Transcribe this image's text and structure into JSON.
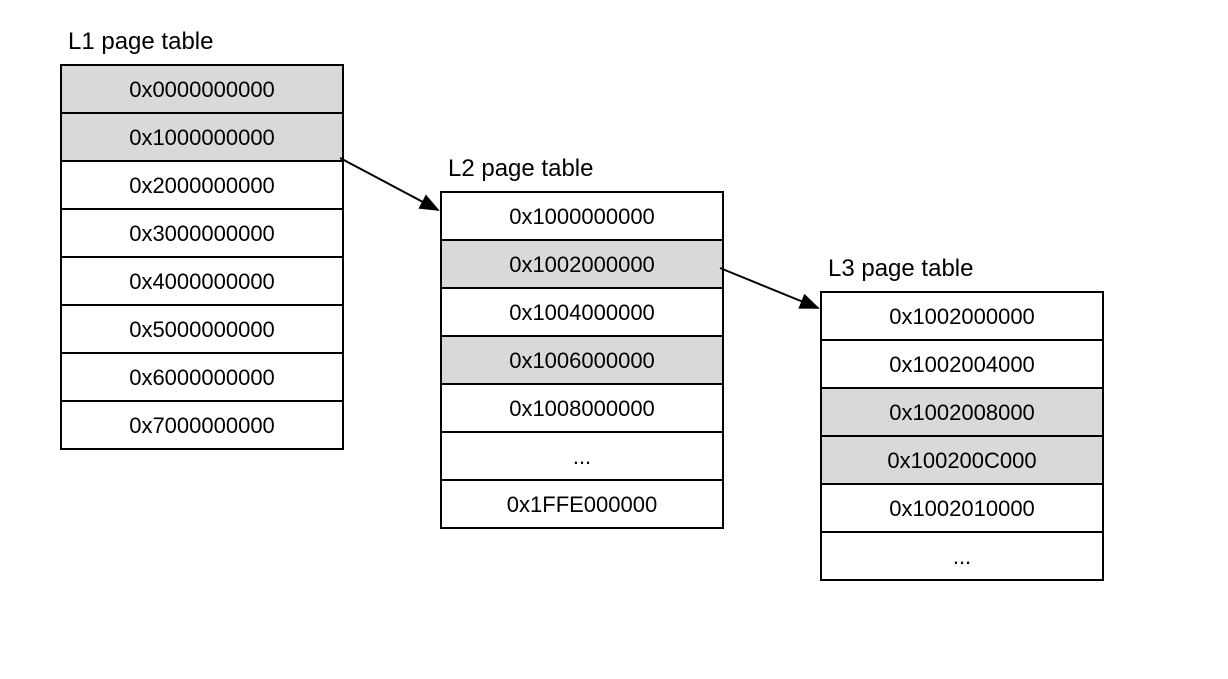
{
  "tables": {
    "l1": {
      "title": "L1 page table",
      "rows": [
        {
          "value": "0x0000000000",
          "shaded": true
        },
        {
          "value": "0x1000000000",
          "shaded": true
        },
        {
          "value": "0x2000000000",
          "shaded": false
        },
        {
          "value": "0x3000000000",
          "shaded": false
        },
        {
          "value": "0x4000000000",
          "shaded": false
        },
        {
          "value": "0x5000000000",
          "shaded": false
        },
        {
          "value": "0x6000000000",
          "shaded": false
        },
        {
          "value": "0x7000000000",
          "shaded": false
        }
      ]
    },
    "l2": {
      "title": "L2 page table",
      "rows": [
        {
          "value": "0x1000000000",
          "shaded": false
        },
        {
          "value": "0x1002000000",
          "shaded": true
        },
        {
          "value": "0x1004000000",
          "shaded": false
        },
        {
          "value": "0x1006000000",
          "shaded": true
        },
        {
          "value": "0x1008000000",
          "shaded": false
        },
        {
          "value": "...",
          "shaded": false
        },
        {
          "value": "0x1FFE000000",
          "shaded": false
        }
      ]
    },
    "l3": {
      "title": "L3 page table",
      "rows": [
        {
          "value": "0x1002000000",
          "shaded": false
        },
        {
          "value": "0x1002004000",
          "shaded": false
        },
        {
          "value": "0x1002008000",
          "shaded": true
        },
        {
          "value": "0x100200C000",
          "shaded": true
        },
        {
          "value": "0x1002010000",
          "shaded": false
        },
        {
          "value": "...",
          "shaded": false
        }
      ]
    }
  }
}
